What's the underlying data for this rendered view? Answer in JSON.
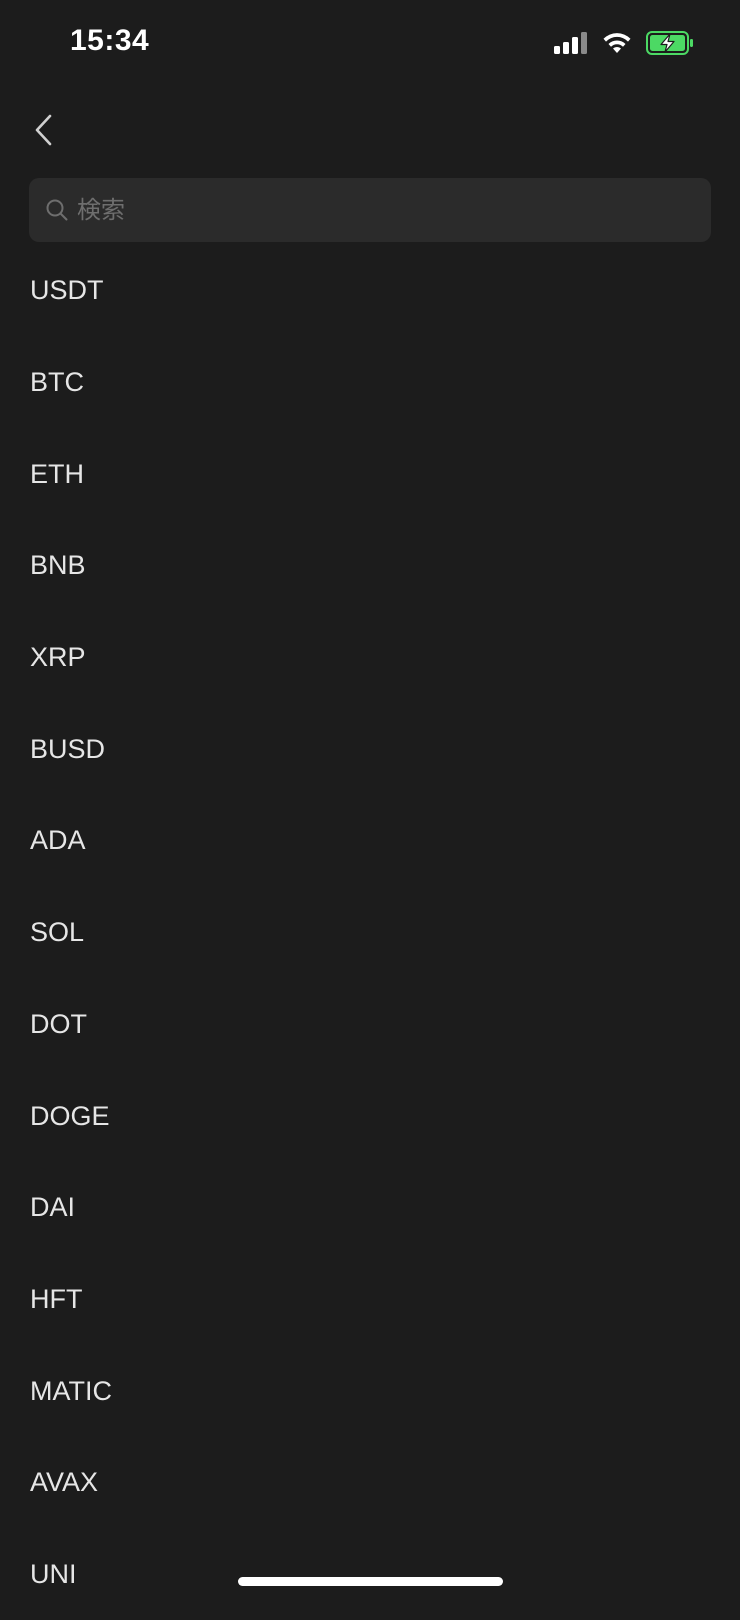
{
  "status_bar": {
    "time": "15:34",
    "icons": [
      "signal-icon",
      "wifi-icon",
      "battery-charging-icon"
    ],
    "battery_color": "#4cd964"
  },
  "nav": {
    "back_icon": "chevron-left-icon"
  },
  "search": {
    "placeholder": "検索",
    "value": ""
  },
  "coins": [
    "USDT",
    "BTC",
    "ETH",
    "BNB",
    "XRP",
    "BUSD",
    "ADA",
    "SOL",
    "DOT",
    "DOGE",
    "DAI",
    "HFT",
    "MATIC",
    "AVAX",
    "UNI"
  ],
  "theme": {
    "background": "#1c1c1c",
    "search_background": "#2b2b2b",
    "text": "#e6e6e6"
  }
}
